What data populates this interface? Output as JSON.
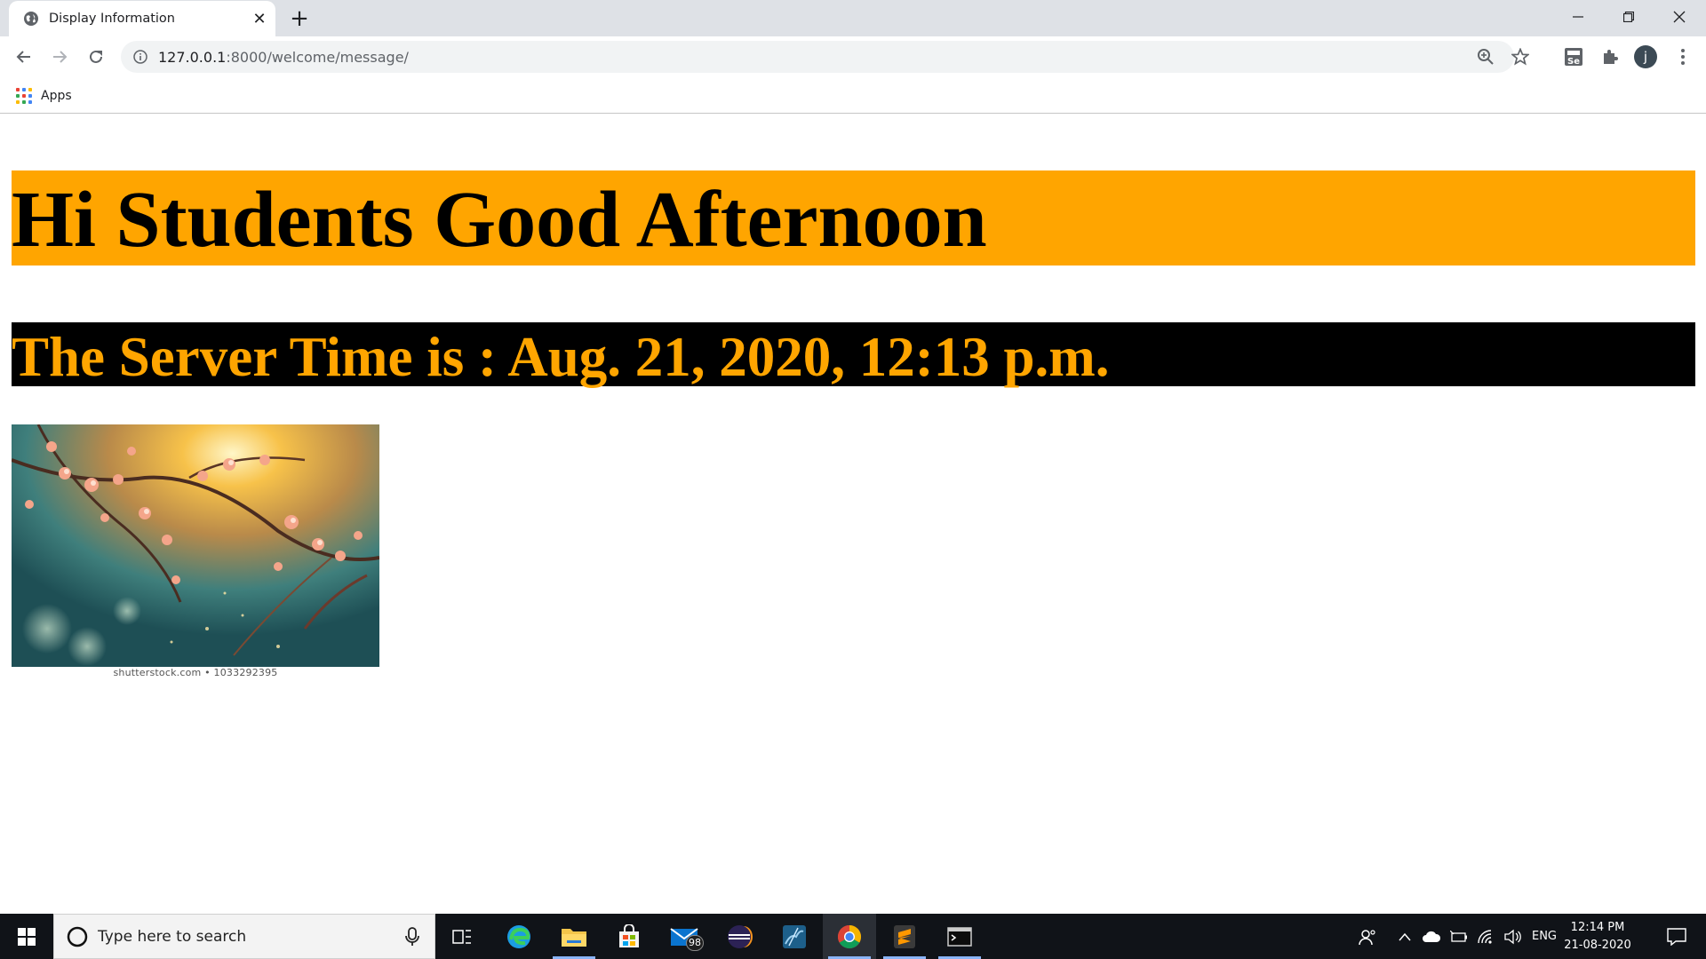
{
  "browser": {
    "tab_title": "Display Information",
    "new_tab_symbol": "+",
    "close_tab_symbol": "✕",
    "url_host": "127.0.0.1",
    "url_rest": ":8000/welcome/message/",
    "profile_initial": "j",
    "bookmarks": {
      "apps_label": "Apps"
    },
    "icons": [
      "globe-favicon",
      "back-arrow-icon",
      "forward-arrow-icon",
      "reload-icon",
      "info-icon",
      "zoom-icon",
      "star-icon",
      "selenium-icon",
      "puzzle-icon",
      "menu-dots-icon",
      "minimize-icon",
      "restore-icon",
      "close-icon"
    ]
  },
  "page": {
    "heading": "Hi Students Good Afternoon",
    "heading_bg": "#ffa500",
    "subheading": "The Server Time is : Aug. 21, 2020, 12:13 p.m.",
    "subheading_bg": "#000000",
    "subheading_color": "#ffa500",
    "image_caption": "shutterstock.com • 1033292395"
  },
  "taskbar": {
    "search_placeholder": "Type here to search",
    "mail_badge": "98",
    "language": "ENG",
    "time": "12:14 PM",
    "date": "21-08-2020",
    "apps": [
      "task-view",
      "edge",
      "file-explorer",
      "store",
      "mail",
      "eclipse",
      "mysql-workbench",
      "chrome",
      "sublime-text",
      "terminal"
    ]
  }
}
